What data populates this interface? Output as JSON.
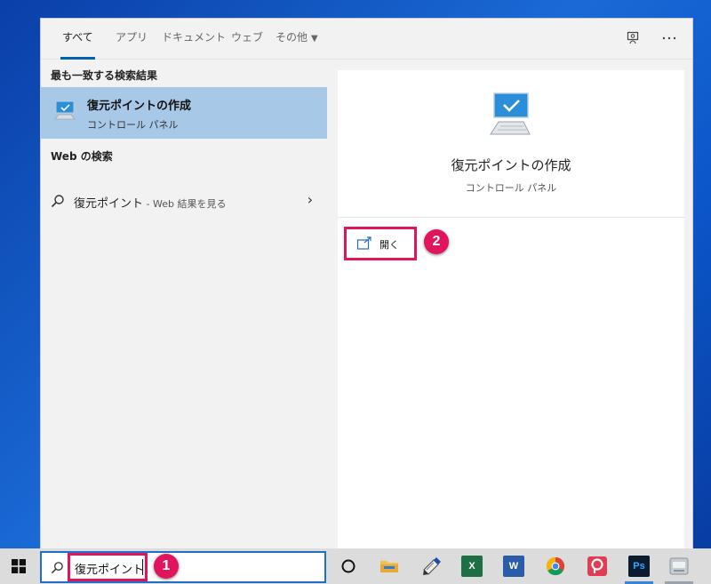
{
  "tabs": [
    {
      "label": "すべて"
    },
    {
      "label": "アプリ"
    },
    {
      "label": "ドキュメント"
    },
    {
      "label": "ウェブ"
    },
    {
      "label": "その他"
    }
  ],
  "left": {
    "best_match_heading": "最も一致する検索結果",
    "best_match": {
      "title": "復元ポイントの作成",
      "subtitle": "コントロール パネル"
    },
    "web_heading": "Web の検索",
    "web_result": {
      "query": "復元ポイント",
      "hint": " - Web 結果を見る"
    }
  },
  "right": {
    "title": "復元ポイントの作成",
    "subtitle": "コントロール パネル",
    "open_label": "開く"
  },
  "badges": {
    "one": "1",
    "two": "2"
  },
  "search": {
    "value": "復元ポイント"
  },
  "colors": {
    "accent": "#0063b1",
    "highlight": "#e0155e",
    "selected_row": "#a8c8e8"
  }
}
